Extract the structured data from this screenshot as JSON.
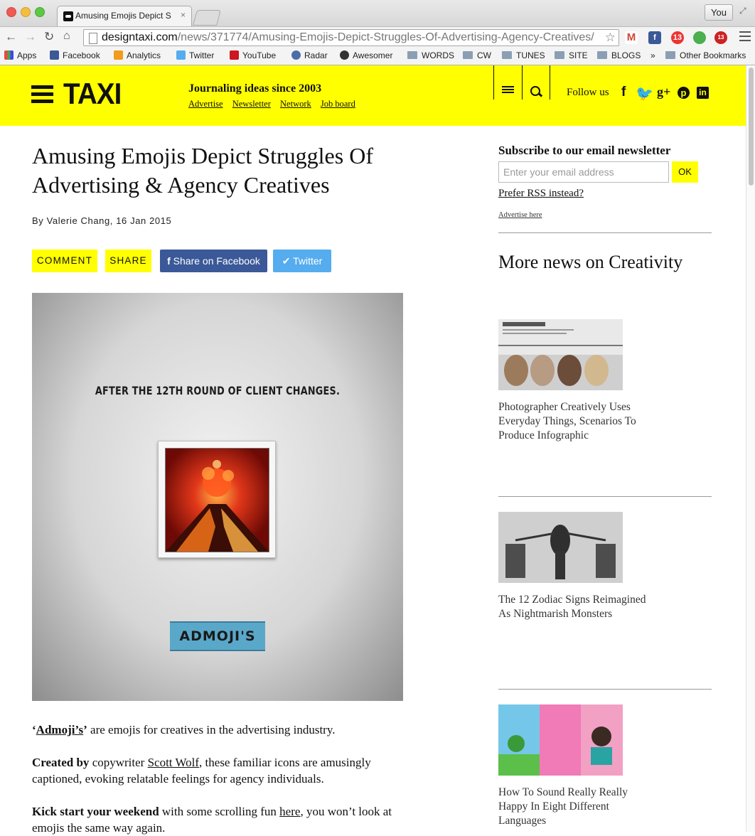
{
  "browser": {
    "tab_title": "Amusing Emojis Depict Str",
    "tab_close": "×",
    "profile_name": "You",
    "url_host": "designtaxi.com",
    "url_path": "/news/371774/Amusing-Emojis-Depict-Struggles-Of-Advertising-Agency-Creatives/",
    "extension_badge_1": "13",
    "extension_badge_2": "13",
    "bookmarks": [
      "Apps",
      "Facebook",
      "Analytics",
      "Twitter",
      "YouTube",
      "Radar",
      "Awesomer",
      "WORDS",
      "CW",
      "TUNES",
      "SITE",
      "BLOGS"
    ],
    "bookmarks_overflow": "»",
    "other_bookmarks": "Other Bookmarks"
  },
  "header": {
    "logo": "TAXI",
    "tagline": "Journaling ideas since 2003",
    "links": [
      "Advertise",
      "Newsletter",
      "Network",
      "Job board"
    ],
    "follow_label": "Follow us",
    "social_icons": [
      "facebook-icon",
      "twitter-icon",
      "google-plus-icon",
      "pinterest-icon",
      "linkedin-icon"
    ]
  },
  "article": {
    "title": "Amusing Emojis Depict Struggles Of Advertising & Agency Creatives",
    "byline": "By Valerie Chang, 16 Jan 2015",
    "buttons": {
      "comment": "COMMENT",
      "share": "SHARE",
      "facebook": "Share on Facebook",
      "twitter": "Twitter"
    },
    "hero": {
      "caption": "AFTER THE 12TH ROUND OF CLIENT CHANGES.",
      "ribbon": "ADMOJI'S"
    },
    "p1": {
      "open_quote": "‘",
      "link": "Admoji’s",
      "close_quote": "’",
      "rest": " are emojis for creatives in the advertising industry."
    },
    "p2": {
      "bold": "Created by",
      "text1": " copywriter ",
      "link": "Scott Wolf",
      "text2": ", these familiar icons are amusingly captioned, evoking relatable feelings for agency individuals."
    },
    "p3": {
      "bold": "Kick start your weekend",
      "text1": " with some scrolling fun ",
      "link": "here",
      "text2": ", you won’t look at emojis the same way again."
    }
  },
  "sidebar": {
    "newsletter_title": "Subscribe to our email newsletter",
    "email_placeholder": "Enter your email address",
    "ok_label": "OK",
    "rss_link": "Prefer RSS instead?",
    "advertise_link": "Advertise here",
    "more_news_title": "More news on Creativity",
    "news": [
      {
        "title": "Photographer Creatively Uses Everyday Things, Scenarios To Produce Infographic"
      },
      {
        "title": "The 12 Zodiac Signs Reimagined As Nightmarish Monsters"
      },
      {
        "title": "How To Sound Really Really Happy In Eight Different Languages"
      }
    ]
  },
  "colors": {
    "accent_yellow": "#ffff00",
    "facebook_blue": "#3b5998",
    "twitter_blue": "#55acee"
  }
}
